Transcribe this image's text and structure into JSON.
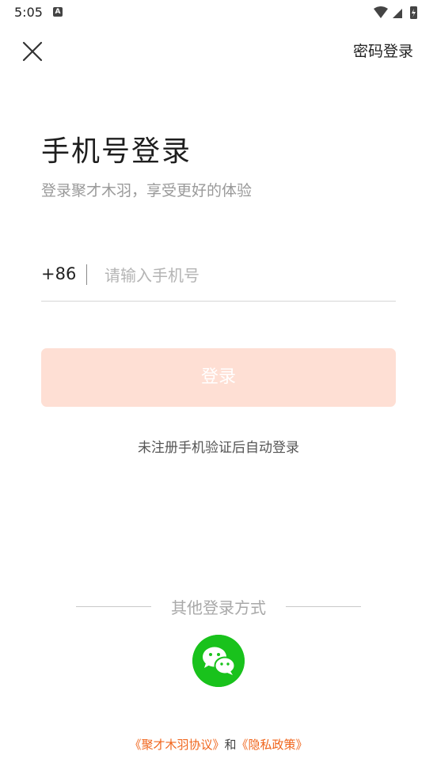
{
  "status_bar": {
    "time": "5:05",
    "notification_icon": "a-letter-icon"
  },
  "topbar": {
    "close_icon": "close-icon",
    "password_login_label": "密码登录"
  },
  "header": {
    "title": "手机号登录",
    "subtitle": "登录聚才木羽，享受更好的体验"
  },
  "phone_field": {
    "country_code": "+86",
    "value": "",
    "placeholder": "请输入手机号"
  },
  "login_button": {
    "label": "登录",
    "background": "#fedfd4"
  },
  "hint": "未注册手机验证后自动登录",
  "other_login": {
    "label": "其他登录方式",
    "wechat_icon": "wechat-icon",
    "wechat_color": "#19c21c"
  },
  "agreement": {
    "user_agreement": "《聚才木羽协议》",
    "joiner": "和",
    "privacy_policy": "《隐私政策》",
    "link_color": "#f0651c"
  }
}
